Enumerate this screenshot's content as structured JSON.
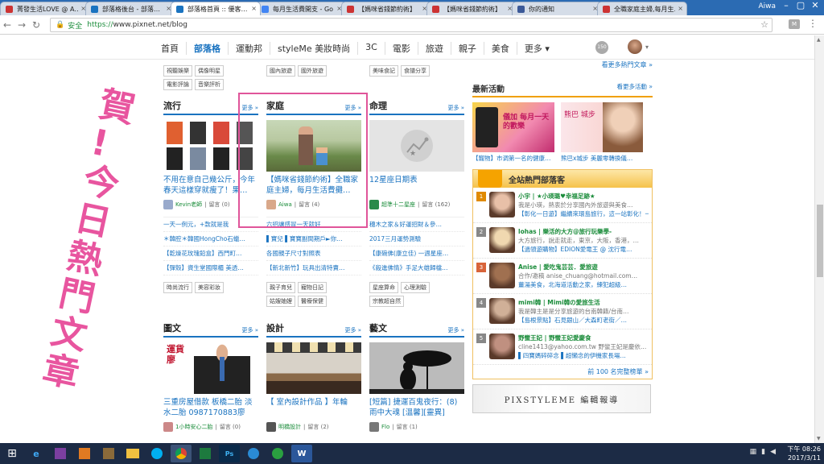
{
  "browser": {
    "tabs": [
      {
        "title": "菁發生活LOVE @ A…",
        "color": "#c33"
      },
      {
        "title": "部落格後台 - 部落…",
        "color": "#1a73c0"
      },
      {
        "title": "部落格首頁 :: 優客…",
        "color": "#1a73c0"
      },
      {
        "title": "每月生活費開支 - Go…",
        "color": "#4285f4"
      },
      {
        "title": "【媽咪省錢節約術】",
        "color": "#c33"
      },
      {
        "title": "【媽咪省錢節約術】",
        "color": "#c33"
      },
      {
        "title": "你的通知",
        "color": "#3b5998"
      },
      {
        "title": "全職家庭主婦,每月生…",
        "color": "#c33"
      }
    ],
    "user": "Aiwa",
    "secure_label": "安全",
    "url_scheme": "https://",
    "url_rest": "www.pixnet.net/blog",
    "ext_label": "M"
  },
  "site_nav": {
    "links": [
      "首頁",
      "部落格",
      "運動邦",
      "styleMe 美妝時尚",
      "3C",
      "電影",
      "旅遊",
      "親子",
      "美食",
      "更多 ▾"
    ],
    "notif_count": "150"
  },
  "left_tags": {
    "col1": [
      [
        "視聽娛樂",
        "偶像明星"
      ],
      [
        "電影評論",
        "音樂評析"
      ]
    ],
    "col2": [
      [
        "國內旅遊",
        "國外旅遊"
      ]
    ],
    "col3": [
      [
        "美味食記",
        "食譜分享"
      ]
    ]
  },
  "sections_row1": [
    {
      "title": "流行",
      "more": "更多 »",
      "post": "不用在意自己幾公斤，今年春天這樣穿就瘦了！果…",
      "author": "Kevin老師",
      "comments": "留言 (0)",
      "links": [
        "一天一例元，+款就是我",
        "＊韓腔＊韓國HongCho石蠟…",
        "【乾燥花玫瑰鉛盒】西門町…",
        "【彈殼】資生堂國際櫃 美透…"
      ],
      "tags": [
        "時尚流行",
        "美容彩妝"
      ]
    },
    {
      "title": "家庭",
      "more": "更多 »",
      "post": "【媽咪省錢節約術】全職家庭主婦，每月生活費攤…",
      "author": "Aiwa",
      "comments": "留言 (4)",
      "links": [
        "六招讓感冒一天就好",
        "▌寶兒 ▌寶寶副間期戶►你…",
        "各國親子尺寸對照表",
        "【新北新竹】玩具出清特賣…"
      ],
      "tags": [
        "親子育兒",
        "寵物日記",
        "姑嫂妯娌",
        "醫療保健"
      ]
    },
    {
      "title": "命理",
      "more": "更多 »",
      "post": "12星座日期表",
      "author": "超準十二星座",
      "comments": "留言 (162)",
      "links": [
        "穗木之家＆好運招財＆參…",
        "2017三月運勢測驗",
        "【康碗佛(康立佳) 一週星座…",
        "《殺進佛情》手足大雄歸檔…"
      ],
      "tags": [
        "星座算命",
        "心理測驗",
        "宗教超自然"
      ]
    }
  ],
  "sections_row2": [
    {
      "title": "圖文",
      "more": "更多 »",
      "post": "三重房屋借款 板橋二胎 淡水二胎 0987170883廖經…",
      "author": "1小時安心二胎",
      "comments": "留言 (0)",
      "img_text": "運貨 廖"
    },
    {
      "title": "設計",
      "more": "更多 »",
      "post": "【 室內設計作品 】年輪",
      "author": "明橋設計",
      "comments": "留言 (2)"
    },
    {
      "title": "藝文",
      "more": "更多 »",
      "post": "[短篇] 捷運百鬼夜行：(8)雨中大魂 [溫馨][靈異]",
      "author": "Flo",
      "comments": "留言 (1)"
    }
  ],
  "sidebar": {
    "top_more": "看更多熱門文章 »",
    "activity_title": "最新活動",
    "activity_more": "看更多活動 »",
    "ads": [
      "【寵物】市调第一名的健康…",
      "熊巴x城步 美麗零轉換儀…"
    ],
    "ad1_text": "儀加 每月一天的歡樂",
    "ad2_text": "熊巴 城步",
    "hot_title": "全站熱門部落客",
    "hot_items": [
      {
        "rank": "1",
        "name": "小宇 | ★小瑛璐♥幸福足跡★",
        "desc": "我是小瑛，熱衷於分享國內外旅遊與美食…",
        "post": "【彰化一日遊】繼續來環島旅行，這一站彰化！一樣會規劃出大家三天的景美…(繼續閱讀)",
        "rank_color": "#e08a00"
      },
      {
        "rank": "2",
        "name": "lohas | 樂活的大方@旅行玩樂學-",
        "desc": "大方旅行，說走就走，東京，大阪，香港，…",
        "post": "【過領遊購物】EDION愛電王 @ 沈行電…",
        "rank_color": "#888"
      },
      {
        "rank": "3",
        "name": "Anise | 愛吃鬼芸芸．愛旅遊",
        "desc": "合作/邀稿 anise_chuang@hotmail.com…",
        "post": "薑湯美食，北海道活動之家，練犯超級…",
        "rank_color": "#d8643a"
      },
      {
        "rank": "4",
        "name": "mimi韓 | Mimi韓の愛旅生活",
        "desc": "我是韓主是是分享旅遊的台南韓籍/台南…",
        "post": "【島根景點】石見銀山／大森町老街／…",
        "rank_color": "#888"
      },
      {
        "rank": "5",
        "name": "野蠻王妃 | 野蠻王妃愛慶食",
        "desc": "cline1413@yahoo.com.tw 野蠻王妃是慶依…",
        "post": "▌四寶媽碎碎念 ▌超懶念的伊機家長場…",
        "rank_color": "#888"
      }
    ],
    "hot_more": "前 100 名完整榜單 »",
    "banner": "PIXSTYLEME 編輯報導"
  },
  "overlay_text": "賀!今日熱門文章",
  "overlay_color": "#e8559f",
  "taskbar": {
    "time": "下午 08:26",
    "date": "2017/3/11"
  }
}
